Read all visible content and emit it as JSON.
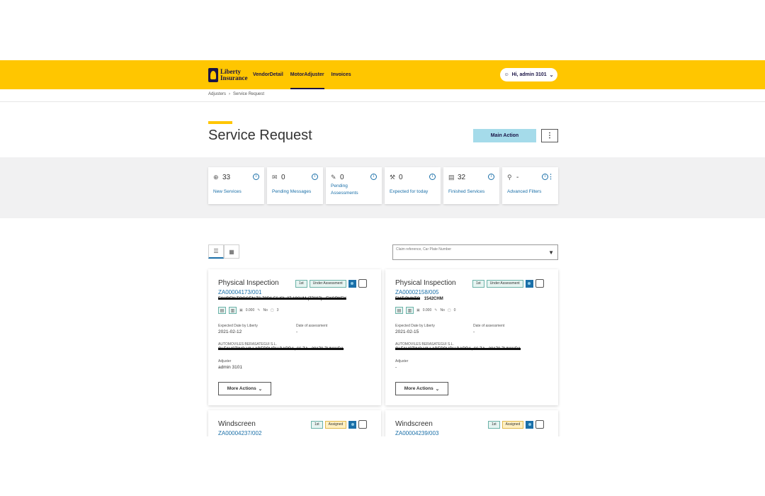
{
  "brand": {
    "logo_line1": "Liberty",
    "logo_line2": "Insurance"
  },
  "nav": [
    {
      "label": "VendorDetail"
    },
    {
      "label": "MotorAdjuster",
      "active": true
    },
    {
      "label": "Invoices"
    }
  ],
  "user": {
    "greeting": "Hi, admin 3101"
  },
  "breadcrumb": {
    "parent": "Adjusters",
    "separator": "›",
    "current": "Service Request"
  },
  "page": {
    "title": "Service Request",
    "main_action": "Main Action",
    "kebab": "⋮"
  },
  "stats": [
    {
      "icon": "inbox-icon",
      "glyph": "⊕",
      "count": "33",
      "label": "New Services"
    },
    {
      "icon": "mail-icon",
      "glyph": "✉",
      "count": "0",
      "label": "Pending Messages"
    },
    {
      "icon": "edit-icon",
      "glyph": "✎",
      "count": "0",
      "label": "Pending Assessments"
    },
    {
      "icon": "tools-icon",
      "glyph": "⚒",
      "count": "0",
      "label": "Expected for today"
    },
    {
      "icon": "clipboard-icon",
      "glyph": "▤",
      "count": "32",
      "label": "Finished Services"
    },
    {
      "icon": "search-icon",
      "glyph": "⚲",
      "count": "-",
      "label": "Advanced Filters"
    }
  ],
  "search": {
    "placeholder": "Claim reference, Car Plate Number"
  },
  "cards": [
    {
      "title": "Physical Inspection",
      "claim": "ZA00004173/001",
      "badges": [
        "1st",
        "Under Assessment"
      ],
      "line1_redacted": "FAUDEN TOGGEN T6 70D1 56 ISL 27 196HM (77607) - EKGPKEY",
      "line1_text": "",
      "meta_amount": "0.000",
      "meta_flag": "No",
      "meta_count": "3",
      "expected_label": "Expected Date by Liberty",
      "expected_value": "2021-02-12",
      "assessment_label": "Date of assessment",
      "assessment_value": "-",
      "workshop": "AUTOMOVILES BERASATEGUI S.L.",
      "workshop_redacted": "C/ FAUSTINO VILLABERBURU BARRA, 66 ZA - 20170 ZUMAIRA",
      "adjuster_label": "Adjuster",
      "adjuster_value": "admin 3101",
      "more_actions": "More Actions"
    },
    {
      "title": "Physical Inspection",
      "claim": "ZA00002158/005",
      "badges": [
        "1st",
        "Under Assessment"
      ],
      "line1_redacted": "FIAT PUNTO",
      "line1_text": "1542CHM",
      "meta_amount": "0.000",
      "meta_flag": "No",
      "meta_count": "0",
      "expected_label": "Expected Date by Liberty",
      "expected_value": "2021-02-15",
      "assessment_label": "Date of assessment",
      "assessment_value": "-",
      "workshop": "AUTOMOVILES BERASATEGUI S.L.",
      "workshop_redacted": "C/ FAUSTINO VILLABERBURU BARRA, 66 ZA - 20170 ZUMAIRA",
      "adjuster_label": "Adjuster",
      "adjuster_value": "-",
      "more_actions": "More Actions"
    },
    {
      "title": "Windscreen",
      "claim": "ZA00004237/002",
      "badges": [
        "1st",
        "Assigned"
      ]
    },
    {
      "title": "Windscreen",
      "claim": "ZA00004239/003",
      "badges": [
        "1st",
        "Assigned"
      ]
    }
  ]
}
